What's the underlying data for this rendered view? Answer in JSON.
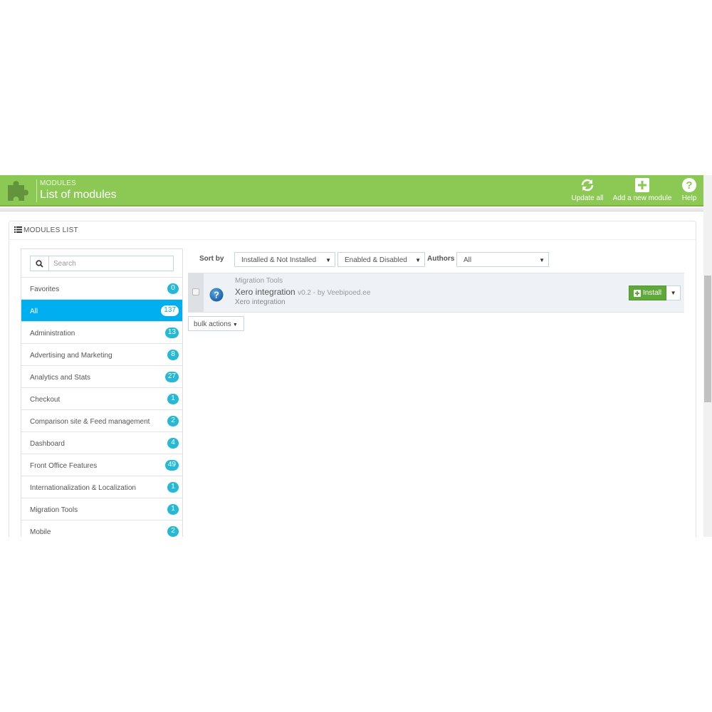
{
  "header": {
    "breadcrumb": "MODULES",
    "title": "List of modules",
    "buttons": [
      {
        "label": "Update all",
        "icon": "refresh-icon"
      },
      {
        "label": "Add a new module",
        "icon": "plus-square-icon"
      },
      {
        "label": "Help",
        "icon": "help-icon"
      }
    ],
    "color": "#8bc954"
  },
  "panel": {
    "title": "MODULES LIST"
  },
  "sidebar": {
    "search_placeholder": "Search",
    "categories": [
      {
        "label": "Favorites",
        "count": "0"
      },
      {
        "label": "All",
        "count": "137",
        "active": true
      },
      {
        "label": "Administration",
        "count": "13"
      },
      {
        "label": "Advertising and Marketing",
        "count": "8"
      },
      {
        "label": "Analytics and Stats",
        "count": "27"
      },
      {
        "label": "Checkout",
        "count": "1"
      },
      {
        "label": "Comparison site & Feed management",
        "count": "2"
      },
      {
        "label": "Dashboard",
        "count": "4"
      },
      {
        "label": "Front Office Features",
        "count": "49"
      },
      {
        "label": "Internationalization & Localization",
        "count": "1"
      },
      {
        "label": "Migration Tools",
        "count": "1"
      },
      {
        "label": "Mobile",
        "count": "2"
      }
    ],
    "active_color": "#00aff0",
    "badge_color": "#25b9d7"
  },
  "toolbar": {
    "sort_label": "Sort by",
    "sort_value": "Installed & Not Installed",
    "status_value": "Enabled & Disabled",
    "authors_label": "Authors",
    "authors_value": "All"
  },
  "module": {
    "category": "Migration Tools",
    "name": "Xero integration",
    "meta": "v0.2 - by Veebipoed.ee",
    "description": "Xero integration",
    "install_label": "Install",
    "install_color": "#5fa83a"
  },
  "bulk_actions_label": "bulk actions"
}
